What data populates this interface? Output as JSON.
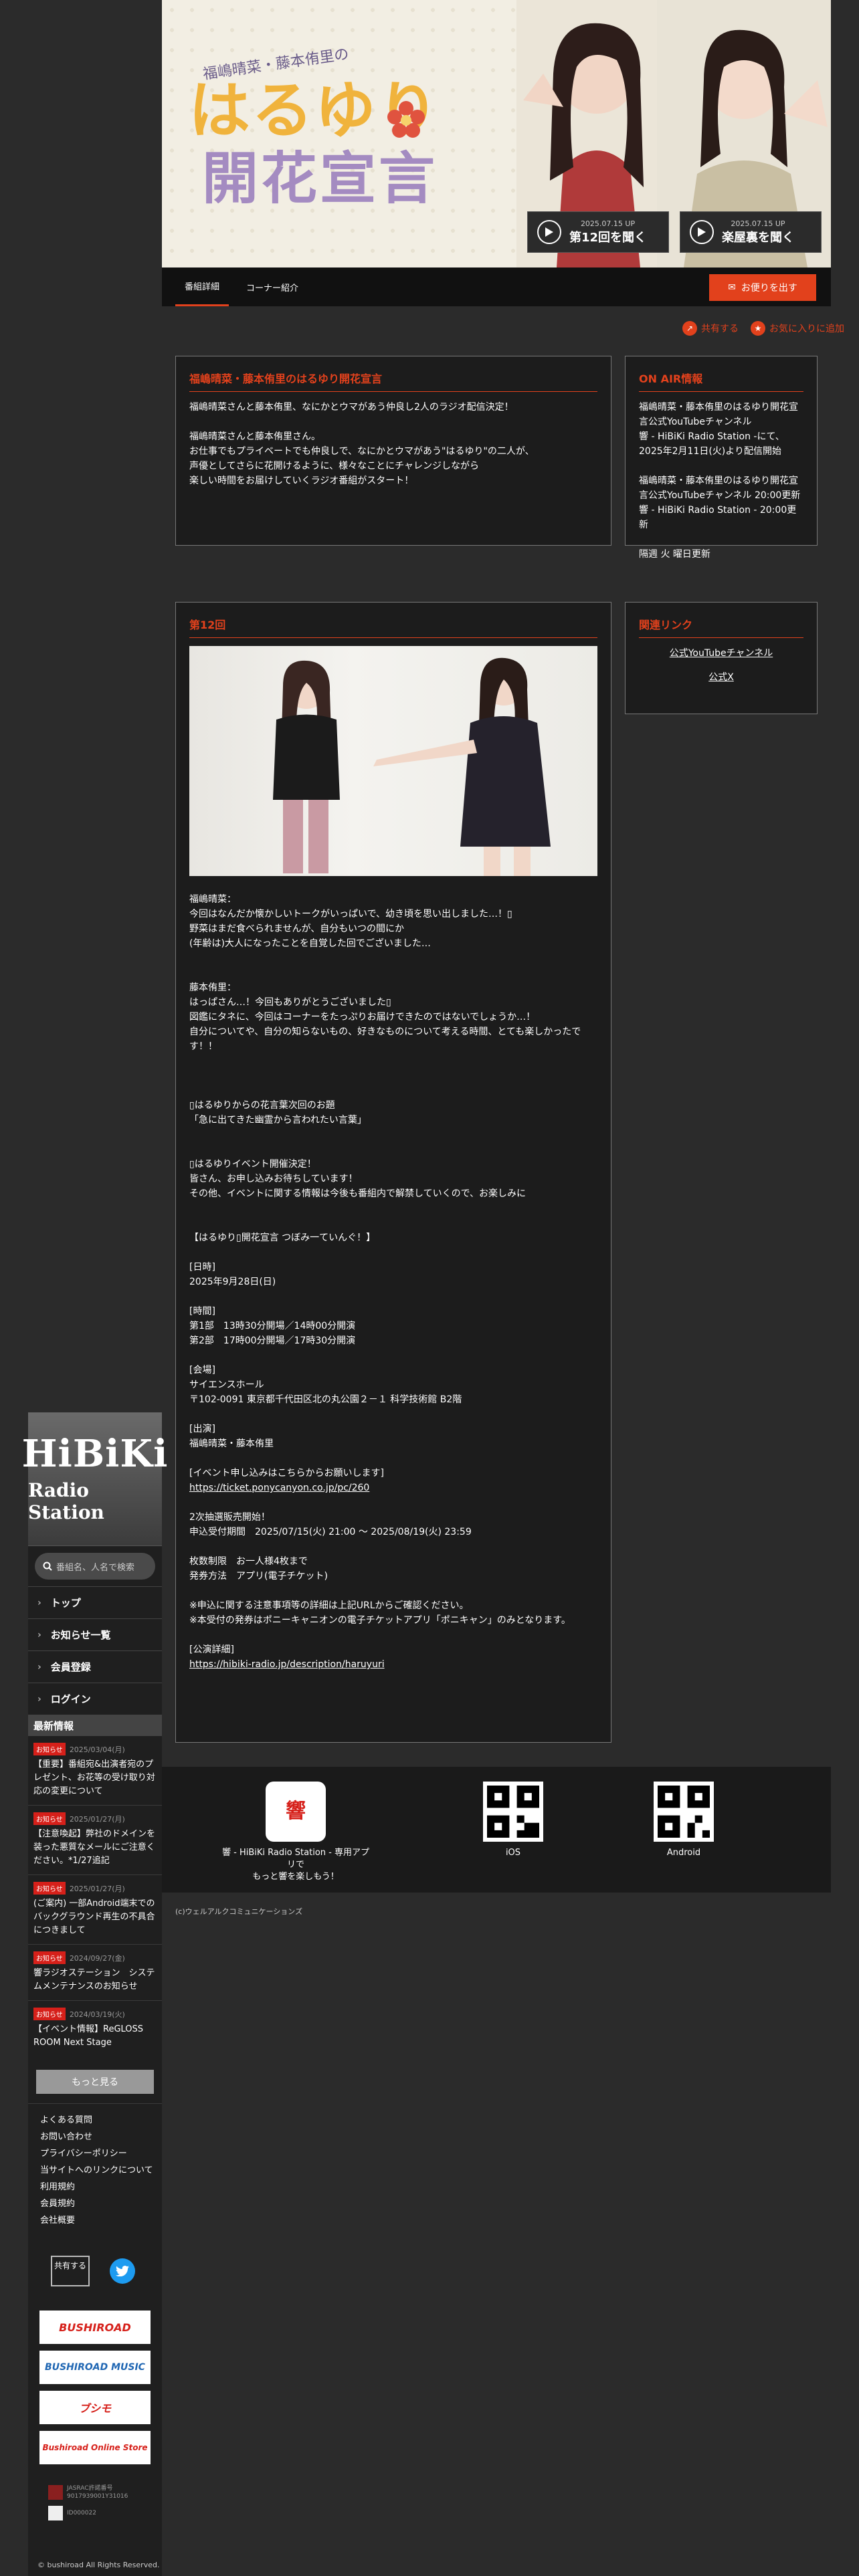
{
  "sidebar": {
    "logo_line1": "HiBiKi",
    "logo_line2": "Radio Station",
    "search_placeholder": "番組名、人名で検索",
    "nav": [
      {
        "label": "トップ"
      },
      {
        "label": "お知らせ一覧"
      },
      {
        "label": "会員登録"
      },
      {
        "label": "ログイン"
      }
    ],
    "news_heading": "最新情報",
    "news": [
      {
        "badge": "お知らせ",
        "date": "2025/03/04(月)",
        "text": "【重要】番組宛&出演者宛のプレゼント、お花等の受け取り対応の変更について"
      },
      {
        "badge": "お知らせ",
        "date": "2025/01/27(月)",
        "text": "【注意喚起】弊社のドメインを装った悪質なメールにご注意ください。*1/27追記"
      },
      {
        "badge": "お知らせ",
        "date": "2025/01/27(月)",
        "text": "(ご案内) 一部Android端末でのバックグラウンド再生の不具合につきまして"
      },
      {
        "badge": "お知らせ",
        "date": "2024/09/27(金)",
        "text": "響ラジオステーション　システムメンテナンスのお知らせ"
      },
      {
        "badge": "お知らせ",
        "date": "2024/03/19(火)",
        "text": "【イベント情報】ReGLOSS ROOM Next Stage"
      }
    ],
    "more_label": "もっと見る",
    "footer_links": [
      "よくある質問",
      "お問い合わせ",
      "プライバシーポリシー",
      "当サイトへのリンクについて",
      "利用規約",
      "会員規約",
      "会社概要"
    ],
    "share_label": "共有する",
    "banners": [
      "BUSHIROAD",
      "BUSHIROAD MUSIC",
      "ブシモ",
      "Bushiroad Online Store"
    ],
    "jasrac_text": "JASRAC許諾番号\n9017939001Y31016",
    "nextone_text": "ID000022",
    "copyright": "© bushiroad All Rights Reserved."
  },
  "hero": {
    "subtitle": "福嶋晴菜・藤本侑里の",
    "title_line1": "はるゆり",
    "title_line2": "開花宣言",
    "btn1": {
      "date": "2025.07.15 UP",
      "label": "第12回を聞く"
    },
    "btn2": {
      "date": "2025.07.15 UP",
      "label": "楽屋裏を聞く"
    }
  },
  "tabs": [
    {
      "label": "番組詳細"
    },
    {
      "label": "コーナー紹介"
    }
  ],
  "mail_label": "お便りを出す",
  "actions": {
    "share": "共有する",
    "favorite": "お気に入りに追加"
  },
  "program": {
    "title": "福嶋晴菜・藤本侑里のはるゆり開花宣言",
    "description": "福嶋晴菜さんと藤本侑里、なにかとウマがあう仲良し2人のラジオ配信決定！\n\n福嶋晴菜さんと藤本侑里さん。\nお仕事でもプライベートでも仲良しで、なにかとウマがあう\"はるゆり\"の二人が、\n声優としてさらに花開けるように、様々なことにチャレンジしながら\n楽しい時間をお届けしていくラジオ番組がスタート！"
  },
  "onair": {
    "title": "ON AIR情報",
    "text": "福嶋晴菜・藤本侑里のはるゆり開花宣言公式YouTubeチャンネル\n響 - HiBiKi Radio Station -にて、2025年2月11日(火)より配信開始\n\n福嶋晴菜・藤本侑里のはるゆり開花宣言公式YouTubeチャンネル 20:00更新\n響 - HiBiKi Radio Station - 20:00更新\n\n隔週 火 曜日更新"
  },
  "related": {
    "title": "関連リンク",
    "links": [
      "公式YouTubeチャンネル",
      "公式X"
    ]
  },
  "episode": {
    "title": "第12回",
    "body": "福嶋晴菜：\n今回はなんだか懐かしいトークがいっぱいで、幼き頃を思い出しました…！▯\n野菜はまだ食べられませんが、自分もいつの間にか\n(年齢は)大人になったことを自覚した回でございました…\n\n\n藤本侑里：\nはっぱさん…！今回もありがとうございました▯\n図鑑にタネに、今回はコーナーをたっぷりお届けできたのではないでしょうか…！\n自分についてや、自分の知らないもの、好きなものについて考える時間、とても楽しかったです！！\n\n\n\n▯はるゆりからの花言葉次回のお題\n「急に出てきた幽霊から言われたい言葉」\n\n\n▯はるゆりイベント開催決定！\n皆さん、お申し込みお待ちしています！\nその他、イベントに関する情報は今後も番組内で解禁していくので、お楽しみに\n\n\n【はるゆり▯開花宣言 つぼみ一ていんぐ！】\n\n[日時]\n2025年9月28日(日)\n\n[時間]\n第1部　13時30分開場／14時00分開演\n第2部　17時00分開場／17時30分開演\n\n[会場]\nサイエンスホール\n〒102-0091 東京都千代田区北の丸公園２－１ 科学技術館 B2階\n\n[出演]\n福嶋晴菜・藤本侑里\n\n[イベント申し込みはこちらからお願いします]",
    "link1": "https://ticket.ponycanyon.co.jp/pc/260",
    "body2": "2次抽選販売開始！\n申込受付期間　2025/07/15(火) 21:00 ～ 2025/08/19(火) 23:59\n\n枚数制限　お一人様4枚まで\n発券方法　アプリ(電子チケット)\n\n※申込に関する注意事項等の詳細は上記URLからご確認ください。\n※本受付の発券はポニーキャニオンの電子チケットアプリ「ポニキャン」のみとなります。\n\n[公演詳細]",
    "link2": "https://hibiki-radio.jp/description/haruyuri"
  },
  "apps": {
    "app_name": "響 - HiBiKi Radio Station - 専用アプリで\nもっと響を楽しもう！",
    "ios": " iOS",
    "android": " Android"
  },
  "footer_company": "(c)ウェルアルクコミュニケーションズ"
}
